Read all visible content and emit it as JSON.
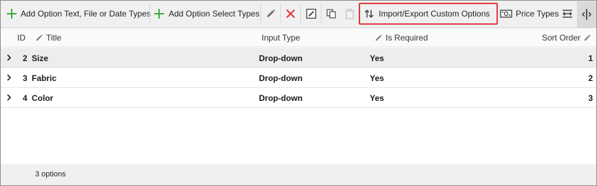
{
  "toolbar": {
    "add_text_types_label": "Add Option Text, File or Date Types",
    "add_select_types_label": "Add Option Select Types",
    "import_export_label": "Import/Export Custom Options",
    "price_types_label": "Price Types"
  },
  "colors": {
    "accent_green": "#3aa83a",
    "delete_red": "#e0393e",
    "highlight_border": "#e0393e",
    "selected_row": "#ededed"
  },
  "grid": {
    "columns": {
      "id": "ID",
      "title": "Title",
      "input_type": "Input Type",
      "is_required": "Is Required",
      "sort_order": "Sort Order"
    },
    "rows": [
      {
        "id": "2",
        "title": "Size",
        "input_type": "Drop-down",
        "is_required": "Yes",
        "sort_order": "1"
      },
      {
        "id": "3",
        "title": "Fabric",
        "input_type": "Drop-down",
        "is_required": "Yes",
        "sort_order": "2"
      },
      {
        "id": "4",
        "title": "Color",
        "input_type": "Drop-down",
        "is_required": "Yes",
        "sort_order": "3"
      }
    ]
  },
  "footer": {
    "count_text": "3 options"
  }
}
